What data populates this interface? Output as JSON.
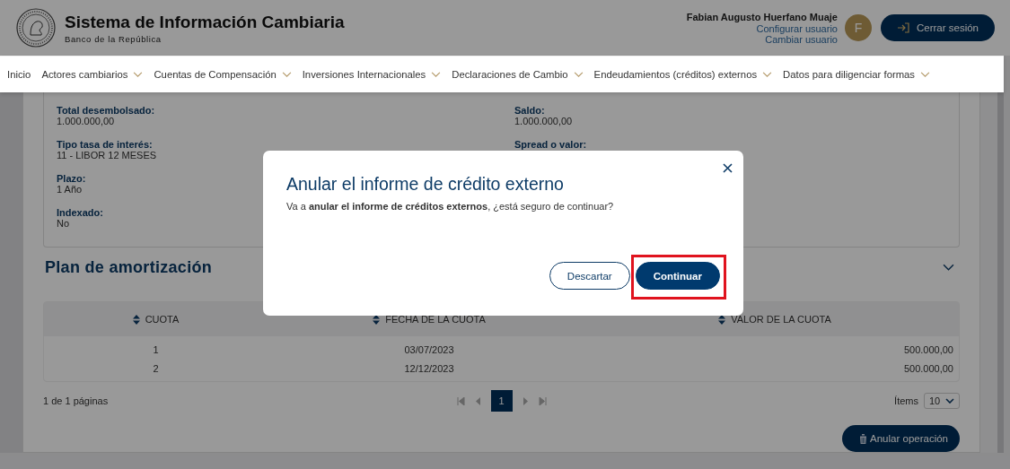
{
  "header": {
    "title": "Sistema de Información Cambiaria",
    "subtitle": "Banco de la República",
    "user_name": "Fabian Augusto Huerfano Muaje",
    "user_links": [
      "Configurar usuario",
      "Cambiar usuario"
    ],
    "avatar_initial": "F",
    "logout_button": "Cerrar sesión"
  },
  "nav": [
    {
      "label": "Inicio",
      "kind": "link"
    },
    {
      "label": "Actores cambiarios",
      "kind": "menu"
    },
    {
      "label": "Cuentas de Compensación",
      "kind": "menu"
    },
    {
      "label": "Inversiones Internacionales",
      "kind": "menu"
    },
    {
      "label": "Declaraciones de Cambio",
      "kind": "menu"
    },
    {
      "label": "Endeudamientos (créditos) externos",
      "kind": "menu"
    },
    {
      "label": "Datos para diligenciar formas",
      "kind": "menu"
    }
  ],
  "details": {
    "columns": [
      [
        {
          "label": "Total desembolsado:",
          "value": "1.000.000,00"
        },
        {
          "label": "Tipo tasa de interés:",
          "value": "11 - LIBOR 12 MESES"
        },
        {
          "label": "Plazo:",
          "value": "1 Año"
        },
        {
          "label": "Indexado:",
          "value": "No"
        }
      ],
      [
        {
          "label": "Saldo:",
          "value": "1.000.000,00"
        },
        {
          "label": "Spread o valor:"
        }
      ]
    ]
  },
  "amortization": {
    "title": "Plan de amortización",
    "table": {
      "columns": [
        "CUOTA",
        "FECHA DE LA CUOTA",
        "VALOR DE LA CUOTA"
      ],
      "rows": [
        [
          "1",
          "03/07/2023",
          "500.000,00"
        ],
        [
          "2",
          "12/12/2023",
          "500.000,00"
        ]
      ]
    },
    "pagination": {
      "summary": "1 de 1 páginas",
      "pages": [
        {
          "label": "1",
          "selected": true
        }
      ],
      "items_label": "Ítems",
      "page_size": "10"
    }
  },
  "action_button": "Anular operación",
  "dialog": {
    "title": "Anular el informe de crédito externo",
    "message": "Va a **anular el informe de créditos externos**, ¿está seguro de continuar?",
    "buttons": [
      {
        "label": "Descartar",
        "kind": "secondary",
        "highlighted": false
      },
      {
        "label": "Continuar",
        "kind": "primary",
        "highlighted": true
      }
    ]
  }
}
